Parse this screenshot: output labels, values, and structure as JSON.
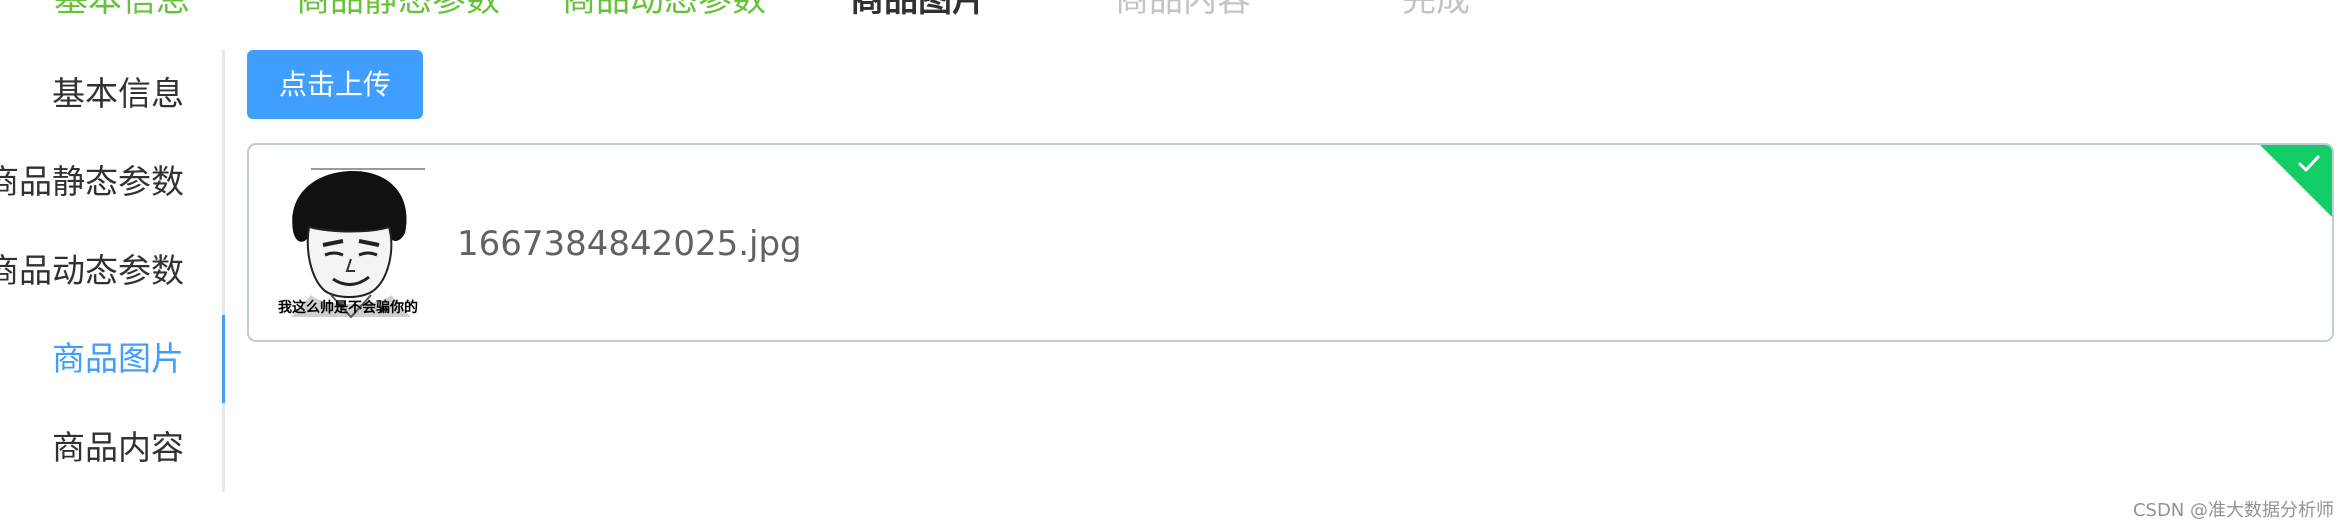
{
  "steps": [
    {
      "label": "基本信息",
      "state": "done"
    },
    {
      "label": "商品静态参数",
      "state": "done"
    },
    {
      "label": "商品动态参数",
      "state": "done"
    },
    {
      "label": "商品图片",
      "state": "active"
    },
    {
      "label": "商品内容",
      "state": "wait"
    },
    {
      "label": "完成",
      "state": "wait"
    }
  ],
  "tabs": [
    {
      "label": "基本信息",
      "active": false
    },
    {
      "label": "商品静态参数",
      "active": false
    },
    {
      "label": "商品动态参数",
      "active": false
    },
    {
      "label": "商品图片",
      "active": true
    },
    {
      "label": "商品内容",
      "active": false
    }
  ],
  "upload": {
    "button_label": "点击上传",
    "file": {
      "thumbnail_caption": "我这么帅是不会骗你的",
      "name": "1667384842025.jpg",
      "status": "success",
      "status_icon": "check-icon"
    }
  },
  "watermark": "CSDN @准大数据分析师",
  "colors": {
    "primary": "#409eff",
    "success_step": "#67c23a",
    "success_badge": "#13ce66",
    "text": "#303133",
    "muted": "#c0c4cc"
  }
}
